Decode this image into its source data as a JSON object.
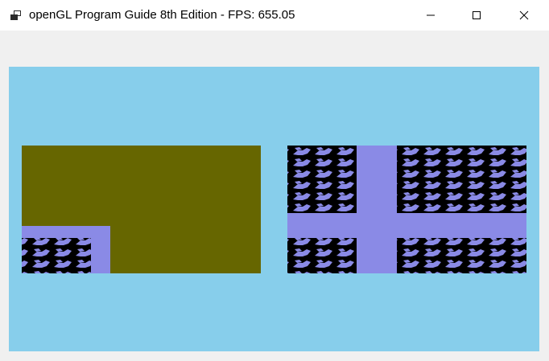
{
  "window": {
    "title": "openGL Program Guide 8th Edition - FPS: 655.05",
    "app_icon": "app-window-icon",
    "controls": {
      "minimize_icon": "minimize-icon",
      "maximize_icon": "maximize-icon",
      "close_icon": "close-icon"
    }
  },
  "scene": {
    "clear_color": "#87ceeb",
    "left_quad": {
      "fill_color": "#666600",
      "border_color": "#8a8ae6",
      "tile_background": "#000000",
      "arrow_color": "#8a8ae6"
    },
    "right_quad": {
      "cross_color": "#8a8ae6",
      "tile_background": "#000000",
      "arrow_color": "#8a8ae6"
    }
  }
}
